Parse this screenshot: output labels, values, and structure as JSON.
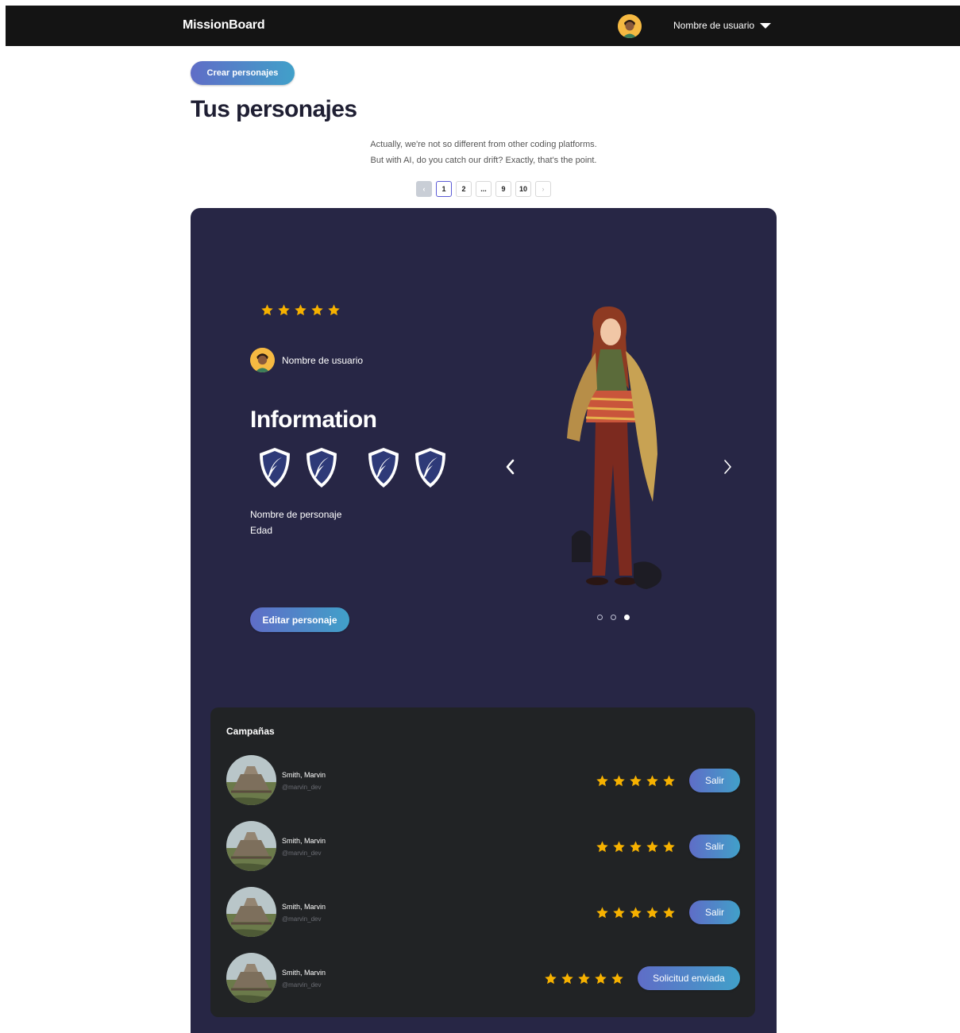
{
  "header": {
    "brand": "MissionBoard",
    "user_name": "Nombre de usuario"
  },
  "toolbar": {
    "create_label": "Crear personajes"
  },
  "page": {
    "title": "Tus personajes",
    "subtitle_line1": "Actually, we're not so different from other coding platforms.",
    "subtitle_line2": "But with AI, do you catch our drift? Exactly, that's the point."
  },
  "pagination": {
    "prev": "‹",
    "pages": [
      "1",
      "2",
      "...",
      "9",
      "10"
    ],
    "next": "›",
    "current": "1"
  },
  "character": {
    "rating": 5,
    "owner": "Nombre de usuario",
    "section_title": "Information",
    "badges": [
      "quill-shield-icon",
      "quill-shield-icon",
      "quill-shield-icon",
      "quill-shield-icon"
    ],
    "name_label": "Nombre de personaje",
    "age_label": "Edad",
    "edit_label": "Editar personaje",
    "carousel_total": 3,
    "carousel_active": 3
  },
  "campaigns": {
    "title": "Campañas",
    "items": [
      {
        "name": "Smith, Marvin",
        "handle": "@marvin_dev",
        "rating": 5,
        "action": "Salir"
      },
      {
        "name": "Smith, Marvin",
        "handle": "@marvin_dev",
        "rating": 5,
        "action": "Salir"
      },
      {
        "name": "Smith, Marvin",
        "handle": "@marvin_dev",
        "rating": 5,
        "action": "Salir"
      },
      {
        "name": "Smith, Marvin",
        "handle": "@marvin_dev",
        "rating": 5,
        "action": "Solicitud enviada"
      }
    ]
  },
  "colors": {
    "header_bg": "#141414",
    "card_bg": "#272645",
    "campaigns_bg": "#212325",
    "star": "#f6b100",
    "button_gradient_start": "#5f6dc7",
    "button_gradient_end": "#41a0c9"
  }
}
